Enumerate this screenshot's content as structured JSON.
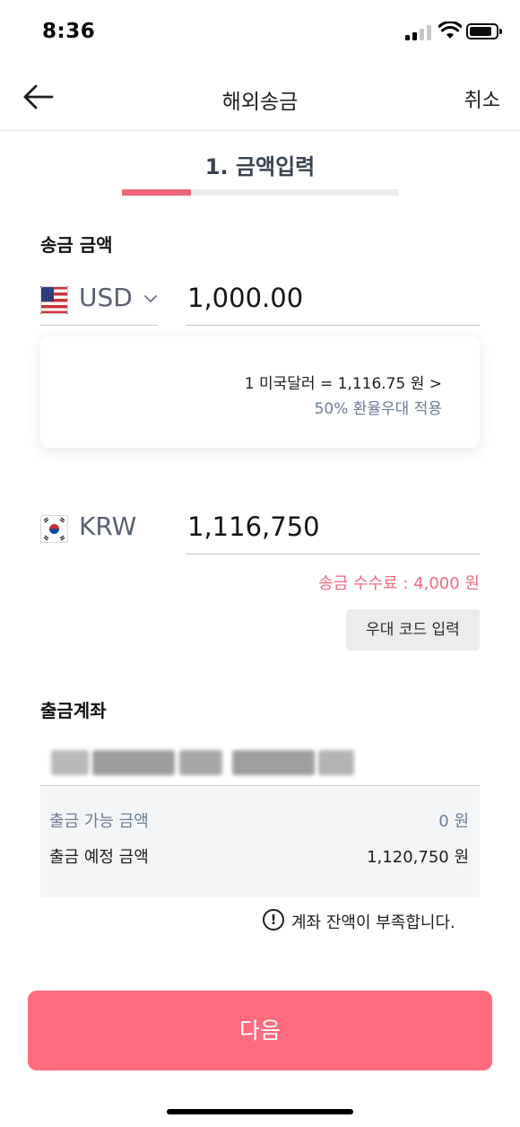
{
  "status_bar": {
    "time": "8:36"
  },
  "nav": {
    "title": "해외송금",
    "cancel_label": "취소"
  },
  "step": {
    "title": "1. 금액입력",
    "progress": 0.25
  },
  "send": {
    "section_label": "송금 금액",
    "currency": "USD",
    "amount": "1,000.00"
  },
  "rate": {
    "line": "1 미국달러 = 1,116.75 원 >",
    "benefit": "50% 환율우대 적용"
  },
  "receive": {
    "currency": "KRW",
    "amount": "1,116,750",
    "fee": "송금 수수료 : 4,000 원",
    "promo_button": "우대 코드 입력"
  },
  "account": {
    "section_label": "출금계좌",
    "available_label": "출금 가능 금액",
    "available_value": "0 원",
    "planned_label": "출금 예정 금액",
    "planned_value": "1,120,750 원",
    "warning": "계좌 잔액이 부족합니다."
  },
  "next_button": "다음",
  "colors": {
    "accent": "#ff6b7d",
    "progress": "#f0647a",
    "fee": "#ef6b7c",
    "muted": "#6d7d95"
  }
}
